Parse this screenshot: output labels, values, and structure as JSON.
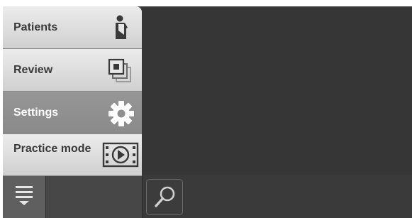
{
  "menu": {
    "items": [
      {
        "label": "Patients",
        "icon": "patient-icon",
        "selected": false
      },
      {
        "label": "Review",
        "icon": "review-images-icon",
        "selected": false
      },
      {
        "label": "Settings",
        "icon": "gear-icon",
        "selected": true
      },
      {
        "label": "Practice mode",
        "icon": "practice-video-icon",
        "selected": false
      }
    ]
  },
  "toolbar": {
    "menu_icon": "hamburger-menu-icon",
    "search_icon": "search-icon"
  },
  "colors": {
    "menu_item_bg": "#e0e0e0",
    "menu_item_selected_bg": "#909090",
    "content_bg": "#363636",
    "bottom_bar_bg": "#3a3a3a"
  }
}
